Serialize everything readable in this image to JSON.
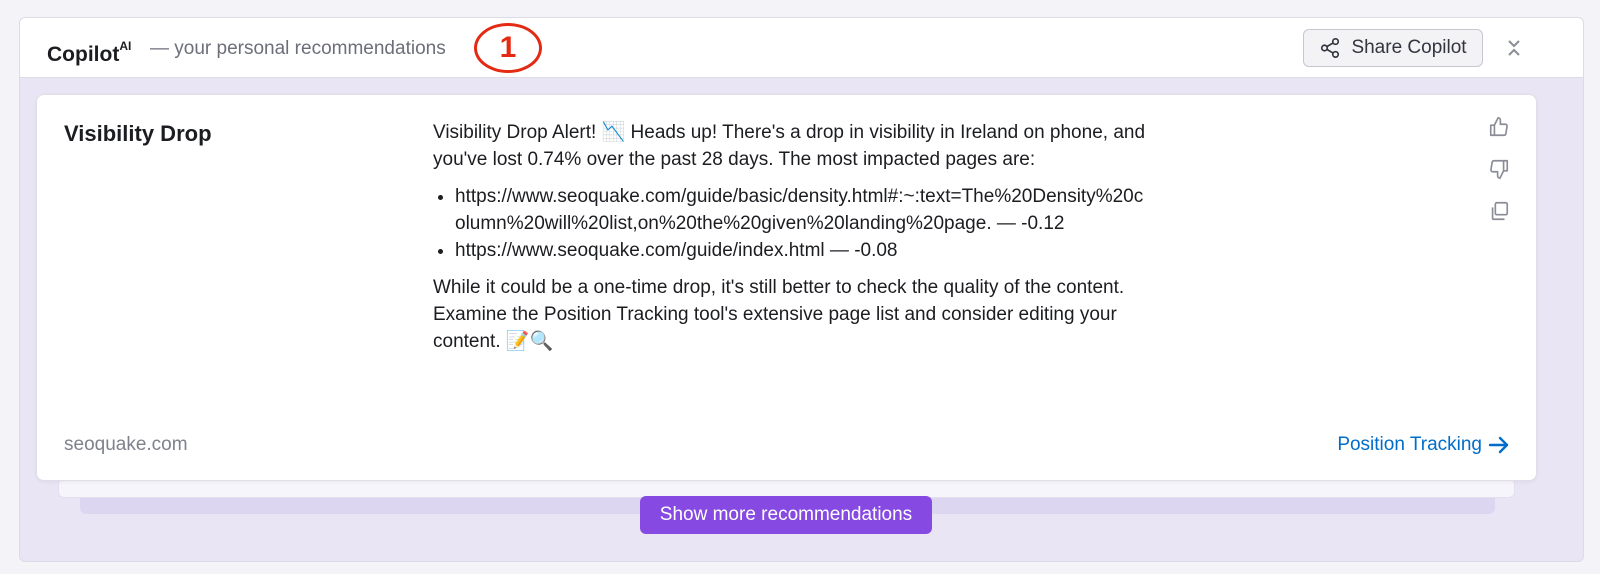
{
  "header": {
    "brand": "Copilot",
    "brand_sup": "AI",
    "subtitle": "— your personal recommendations",
    "annotation_number": "1",
    "share_label": "Share Copilot"
  },
  "card": {
    "title": "Visibility Drop",
    "intro": "Visibility Drop Alert! 📉 Heads up! There's a drop in visibility in Ireland on phone, and you've lost 0.74% over the past 28 days. The most impacted pages are:",
    "pages": [
      "https://www.seoquake.com/guide/basic/density.html#:~:text=The%20Density%20column%20will%20list,on%20the%20given%20landing%20page. — -0.12",
      "https://www.seoquake.com/guide/index.html — -0.08"
    ],
    "outro": "While it could be a one-time drop, it's still better to check the quality of the content. Examine the Position Tracking tool's extensive page list and consider editing your content. 📝🔍",
    "domain": "seoquake.com",
    "tool_link": "Position Tracking",
    "icons": [
      "thumbs-up-icon",
      "thumbs-down-icon",
      "copy-icon"
    ]
  },
  "footer": {
    "show_more_label": "Show more recommendations"
  },
  "colors": {
    "accent": "#8649e1",
    "link": "#006dca",
    "annotation": "#e52a14"
  }
}
